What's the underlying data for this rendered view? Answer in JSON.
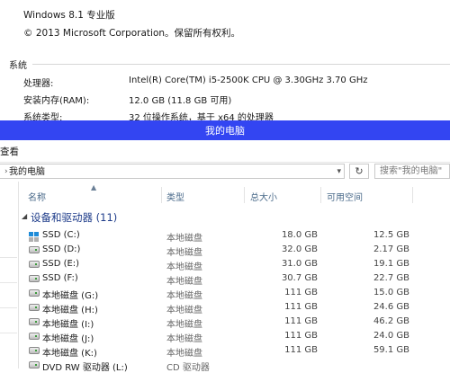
{
  "system_info": {
    "edition": "Windows 8.1 专业版",
    "copyright": "© 2013 Microsoft Corporation。保留所有权利。",
    "section_title": "系统",
    "rows": [
      {
        "label": "处理器:",
        "value": "Intel(R) Core(TM) i5-2500K CPU @ 3.30GHz   3.70 GHz"
      },
      {
        "label": "安装内存(RAM):",
        "value": "12.0 GB (11.8 GB 可用)"
      },
      {
        "label": "系统类型:",
        "value": "32 位操作系统，基于 x64 的处理器"
      }
    ]
  },
  "window": {
    "title": "我的电脑",
    "menu_view": "查看",
    "address": "我的电脑",
    "search_placeholder": "搜索\"我的电脑\""
  },
  "columns": {
    "name": "名称",
    "type": "类型",
    "total": "总大小",
    "free": "可用空间"
  },
  "group_label": "设备和驱动器 (11)",
  "drives": [
    {
      "name": "SSD (C:)",
      "type": "本地磁盘",
      "total": "18.0 GB",
      "free": "12.5 GB",
      "icon": "windows-drive-icon"
    },
    {
      "name": "SSD (D:)",
      "type": "本地磁盘",
      "total": "32.0 GB",
      "free": "2.17 GB",
      "icon": "hard-drive-icon"
    },
    {
      "name": "SSD (E:)",
      "type": "本地磁盘",
      "total": "31.0 GB",
      "free": "19.1 GB",
      "icon": "hard-drive-icon"
    },
    {
      "name": "SSD (F:)",
      "type": "本地磁盘",
      "total": "30.7 GB",
      "free": "22.7 GB",
      "icon": "hard-drive-icon"
    },
    {
      "name": "本地磁盘 (G:)",
      "type": "本地磁盘",
      "total": "111 GB",
      "free": "15.0 GB",
      "icon": "hard-drive-icon"
    },
    {
      "name": "本地磁盘 (H:)",
      "type": "本地磁盘",
      "total": "111 GB",
      "free": "24.6 GB",
      "icon": "hard-drive-icon"
    },
    {
      "name": "本地磁盘 (I:)",
      "type": "本地磁盘",
      "total": "111 GB",
      "free": "46.2 GB",
      "icon": "hard-drive-icon"
    },
    {
      "name": "本地磁盘 (J:)",
      "type": "本地磁盘",
      "total": "111 GB",
      "free": "24.0 GB",
      "icon": "hard-drive-icon"
    },
    {
      "name": "本地磁盘 (K:)",
      "type": "本地磁盘",
      "total": "111 GB",
      "free": "59.1 GB",
      "icon": "hard-drive-icon"
    },
    {
      "name": "DVD RW 驱动器 (L:)",
      "type": "CD 驱动器",
      "total": "",
      "free": "",
      "icon": "optical-drive-icon"
    }
  ],
  "colors": {
    "titlebar": "#3345f2",
    "group_text": "#1e3c8a",
    "header_text": "#4a6a8a"
  }
}
